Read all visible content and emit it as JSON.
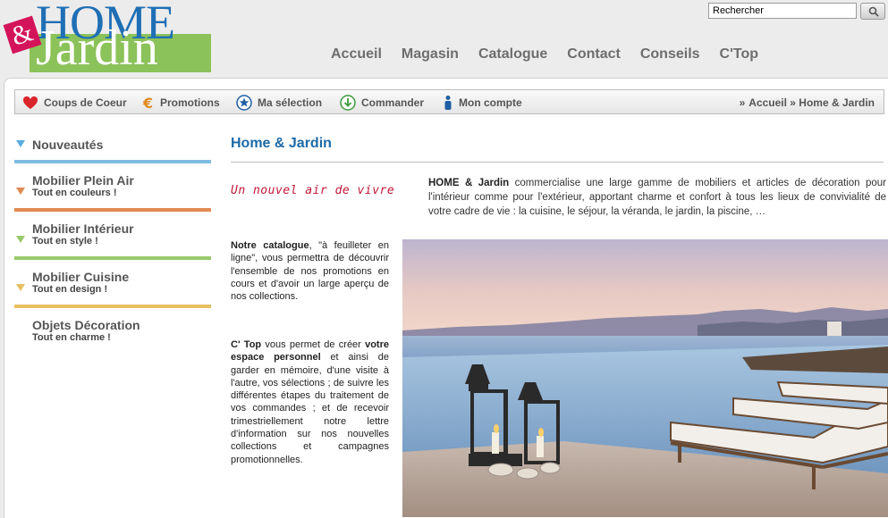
{
  "logo": {
    "amp": "&",
    "home": "HOME",
    "jardin": "Jardin"
  },
  "search": {
    "value": "Rechercher",
    "button_icon": "search-icon"
  },
  "topnav": [
    "Accueil",
    "Magasin",
    "Catalogue",
    "Contact",
    "Conseils",
    "C'Top"
  ],
  "toolbar": {
    "items": [
      {
        "label": "Coups de Coeur",
        "icon": "heart-icon"
      },
      {
        "label": "Promotions",
        "icon": "euro-icon"
      },
      {
        "label": "Ma sélection",
        "icon": "star-icon"
      },
      {
        "label": "Commander",
        "icon": "arrow-down-icon"
      },
      {
        "label": "Mon compte",
        "icon": "user-icon"
      }
    ],
    "breadcrumb": "Accueil » Home & Jardin"
  },
  "sidebar": {
    "items": [
      {
        "title": "Nouveautés",
        "sub": "",
        "color": "#7fbde3"
      },
      {
        "title": "Mobilier Plein Air",
        "sub": "Tout en couleurs !",
        "color": "#e08a52"
      },
      {
        "title": "Mobilier Intérieur",
        "sub": "Tout en style !",
        "color": "#98c96b"
      },
      {
        "title": "Mobilier Cuisine",
        "sub": "Tout en design !",
        "color": "#e6c061"
      },
      {
        "title": "Objets Décoration",
        "sub": "Tout en charme !",
        "color": ""
      }
    ]
  },
  "content": {
    "title": "Home & Jardin",
    "tagline": "Un nouvel air de vivre",
    "intro_bold": "HOME & Jardin",
    "intro_text": " commercialise une large gamme de mobiliers et articles de décoration pour l'intérieur comme pour l'extérieur, apportant charme et confort à tous les lieux de convivialité de votre cadre de vie : la cuisine, le séjour, la véranda, le jardin, la piscine, …",
    "catalogue_bold": "Notre catalogue",
    "catalogue_text": ", \"à feuilleter en ligne\", vous permettra de découvrir l'ensemble de nos promotions en cours et d'avoir un large aperçu de nos collections.",
    "ctop_bold": "C' Top",
    "ctop_text1": " vous permet de créer ",
    "ctop_bold2": "votre espace personnel",
    "ctop_text2": " et ainsi de garder en mémoire, d'une visite à l'autre, vos sélections ; de suivre les différentes étapes du traitement de vos commandes ; et de recevoir trimestriellement notre lettre d'information sur nos nouvelles collections et campagnes promotionnelles."
  },
  "colors": {
    "brand_blue": "#1f6fb5",
    "brand_green": "#8cc25a",
    "brand_pink": "#d4145a",
    "title_blue": "#1c6aa6"
  }
}
